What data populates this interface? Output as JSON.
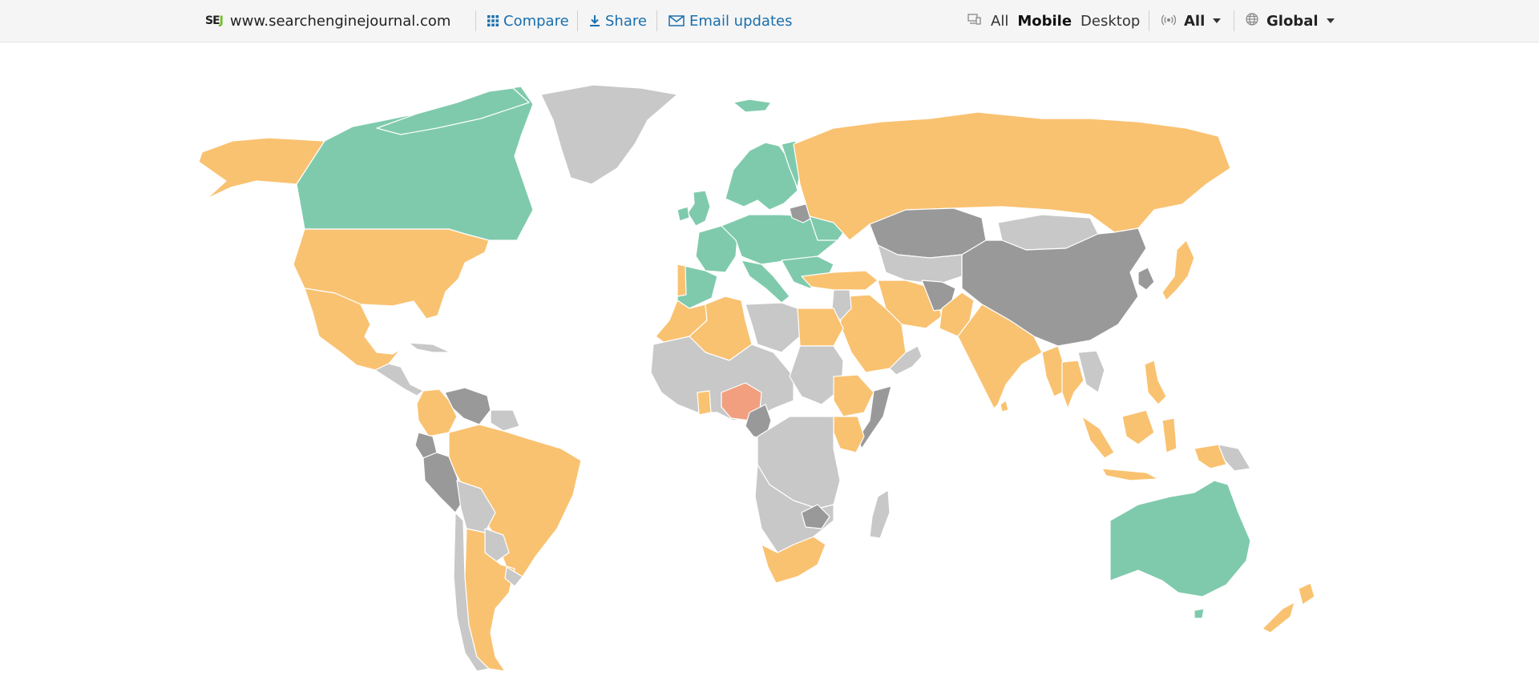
{
  "header": {
    "logo_text": "SEJ",
    "domain": "www.searchenginejournal.com",
    "compare_label": "Compare",
    "share_label": "Share",
    "email_label": "Email updates",
    "device_all": "All",
    "device_mobile": "Mobile",
    "device_desktop": "Desktop",
    "network_value": "All",
    "region_value": "Global",
    "icons": [
      "grid-icon",
      "download-icon",
      "envelope-icon",
      "devices-icon",
      "signal-icon",
      "globe-icon",
      "caret-down-icon"
    ]
  },
  "map": {
    "legend_colors": {
      "highest": "#7fcaad",
      "medium": "#f9c271",
      "lowest": "#f19f7f",
      "no_rank": "#999999",
      "no_data": "#c8c8c8"
    },
    "selected_device": "Mobile",
    "scope": "Global"
  }
}
